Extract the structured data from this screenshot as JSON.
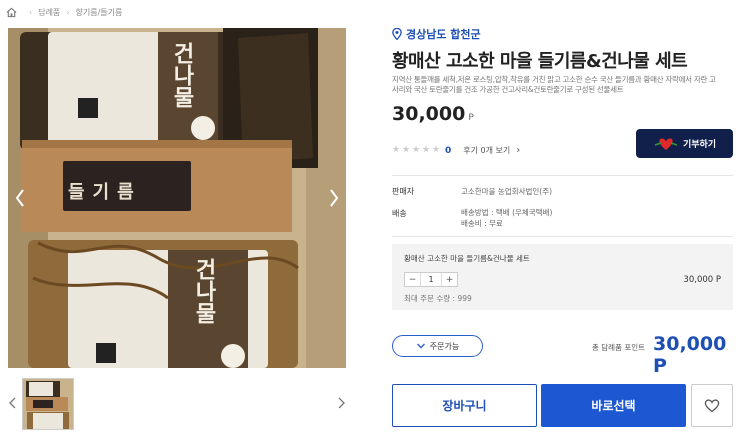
{
  "breadcrumb": {
    "items": [
      "담례품",
      "향기름/들기름"
    ]
  },
  "gallery": {
    "pkg_label_top": "건나물",
    "pkg_label_bottom": "건나물",
    "center_label": "들기름"
  },
  "product": {
    "region": "경상남도 합천군",
    "title": "황매산 고소한 마을 들기름&건나물 세트",
    "desc_line1": "지역산 통들깨를 세척,저온 로스팅,압착,착유를 거친 맑고 고소한 순수 국산 들기름과 황매산 자락에서 자란 고",
    "desc_line2": "사리와 국산 토란줄기를 건조 가공한 건고사리&건토란줄기로 구성된 선물세트",
    "price": "30,000",
    "price_unit": "P",
    "rating_score": "0",
    "review_text": "후기 0개 보기",
    "donate_label": "기부하기"
  },
  "info": {
    "seller_label": "판매자",
    "seller_value": "고소한마을 농업회사법인(주)",
    "shipping_label": "배송",
    "shipping_method": "배송방법 : 택배 (우체국택배)",
    "shipping_fee": "배송비 : 무료"
  },
  "option": {
    "name": "황매산 고소한 마을 들기름&건나물 세트",
    "qty_minus": "−",
    "qty": "1",
    "qty_plus": "+",
    "price": "30,000 P",
    "max": "최대 주문 수량 : 999"
  },
  "order": {
    "pill_label": "주문가능",
    "total_label": "총 담례품 포인트",
    "total_price": "30,000 P"
  },
  "actions": {
    "cart_label": "장바구니",
    "buy_label": "바로선택"
  },
  "colors": {
    "accent": "#1e4fb4",
    "buy_button": "#1e57d2",
    "donate_button": "#10204a"
  }
}
